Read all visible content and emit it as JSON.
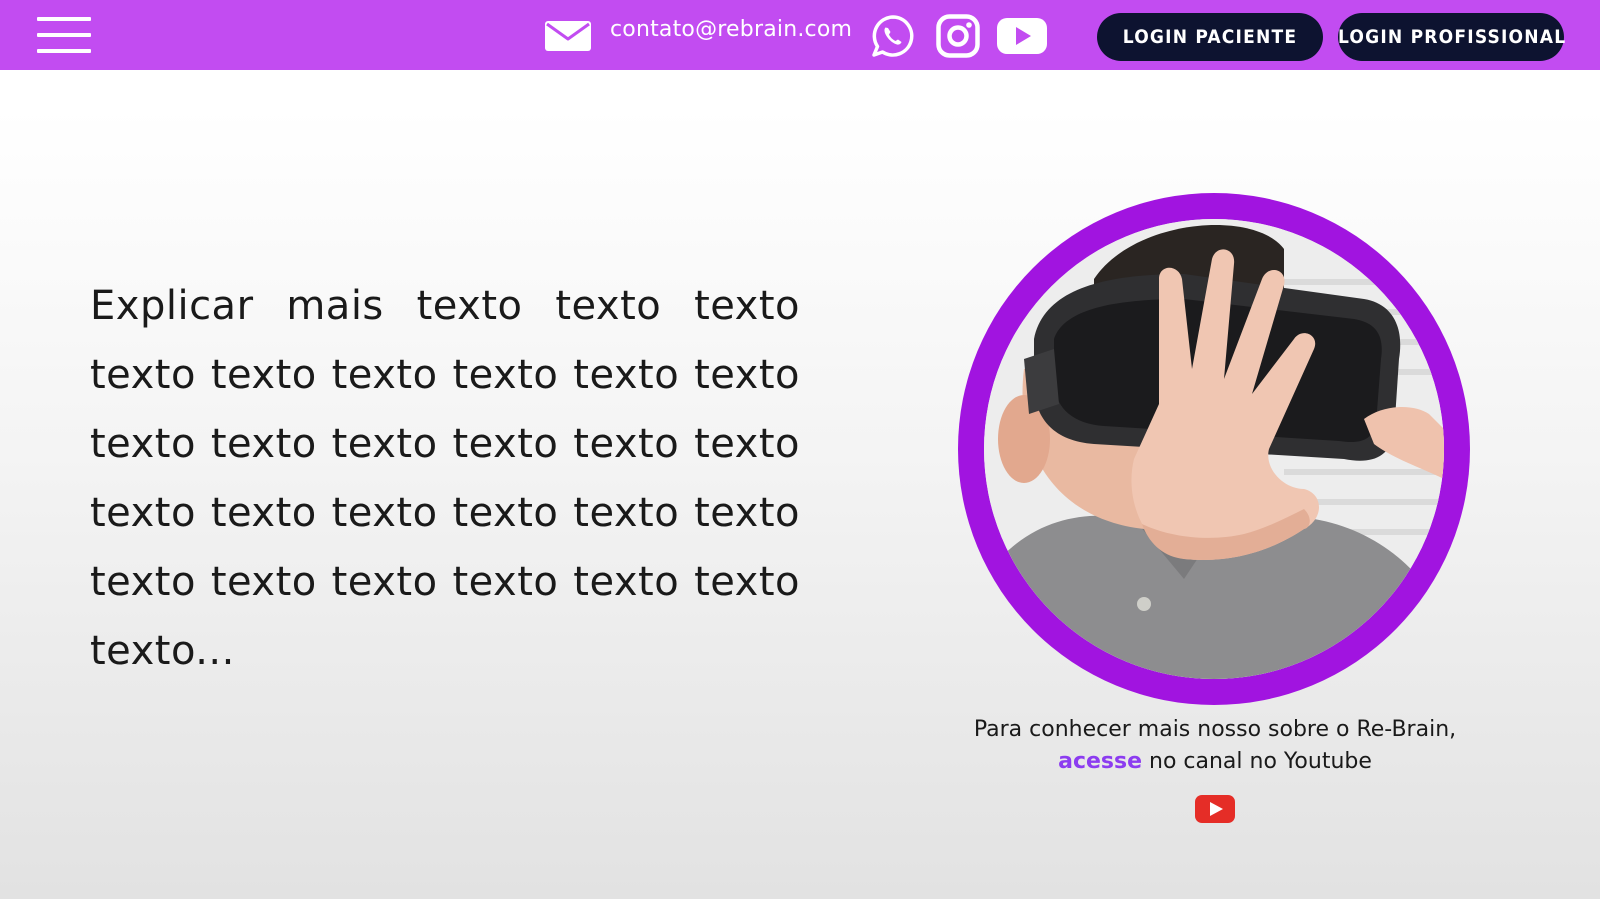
{
  "header": {
    "email": "contato@rebrain.com",
    "social": [
      {
        "name": "WhatsApp",
        "icon": "whatsapp-icon"
      },
      {
        "name": "Instagram",
        "icon": "instagram-icon"
      },
      {
        "name": "YouTube",
        "icon": "youtube-icon"
      }
    ],
    "login_paciente": "LOGIN PACIENTE",
    "login_profissional": "LOGIN PROFISSIONAL"
  },
  "main": {
    "intro_text": "Explicar mais texto texto texto texto texto texto texto texto texto texto texto texto texto texto texto texto texto texto texto texto texto texto texto texto texto texto texto texto..."
  },
  "caption": {
    "line1": "Para conhecer mais nosso sobre o Re-Brain,",
    "accent": "acesse",
    "line2_rest": " no canal no Youtube"
  },
  "colors": {
    "header_bg": "#c24cf1",
    "button_bg": "#0d1330",
    "circle_ring": "#a114e0",
    "accent_text": "#8c3cf0",
    "youtube_red": "#e52d27"
  }
}
